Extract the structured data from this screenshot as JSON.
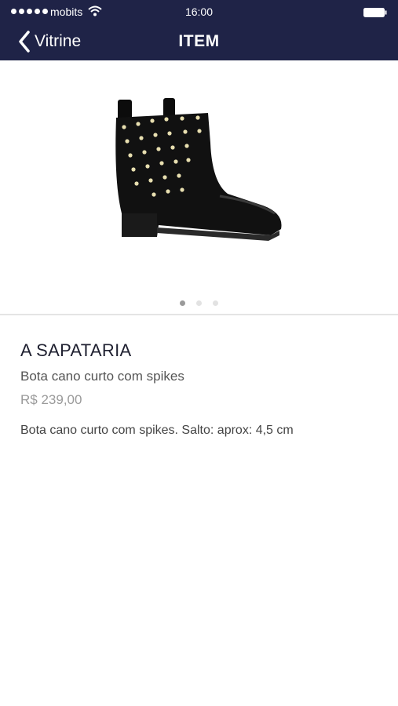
{
  "status_bar": {
    "carrier": "mobits",
    "time": "16:00",
    "signal_icon": "signal-dots-icon",
    "wifi_icon": "wifi-icon",
    "battery_icon": "battery-icon"
  },
  "nav": {
    "back_label": "Vitrine",
    "back_icon": "chevron-left-icon",
    "title": "ITEM"
  },
  "carousel": {
    "image_icon": "ankle-boot-with-studs",
    "pages": 3,
    "active_page": 1
  },
  "product": {
    "brand": "A SAPATARIA",
    "name": "Bota cano curto com spikes",
    "price": "R$ 239,00",
    "description": "Bota cano curto com spikes. Salto: aprox: 4,5 cm"
  },
  "colors": {
    "header_bg": "#1f2347",
    "header_text": "#ffffff",
    "price_text": "#9a9a9a"
  }
}
